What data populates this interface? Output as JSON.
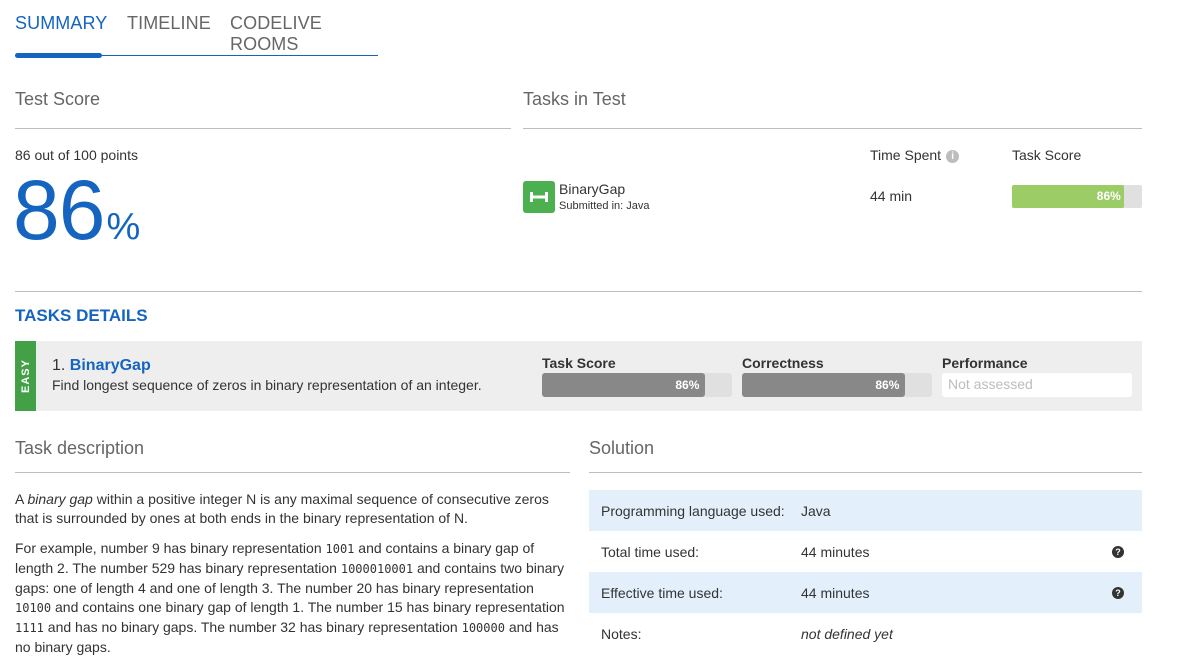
{
  "tabs": [
    "SUMMARY",
    "TIMELINE",
    "CODELIVE ROOMS"
  ],
  "test_score": {
    "title": "Test Score",
    "points_text": "86 out of 100 points",
    "percent_value": "86",
    "percent_sign": "%"
  },
  "tasks_in_test": {
    "title": "Tasks in Test",
    "time_spent_label": "Time Spent",
    "task_score_label": "Task Score",
    "task": {
      "name": "BinaryGap",
      "submitted": "Submitted in: Java",
      "time": "44 min",
      "score_label": "86%",
      "score_fraction": 0.86
    }
  },
  "tasks_details": {
    "title": "TASKS DETAILS",
    "row": {
      "difficulty": "EASY",
      "number": "1.",
      "name": "BinaryGap",
      "description": "Find longest sequence of zeros in binary representation of an integer.",
      "task_score_label": "Task Score",
      "task_score_value": "86%",
      "task_score_fraction": 0.86,
      "correctness_label": "Correctness",
      "correctness_value": "86%",
      "correctness_fraction": 0.86,
      "performance_label": "Performance",
      "performance_value": "Not assessed"
    }
  },
  "task_description": {
    "title": "Task description",
    "p1_a": "A ",
    "p1_em": "binary gap",
    "p1_b": " within a positive integer N is any maximal sequence of consecutive zeros that is surrounded by ones at both ends in the binary representation of N.",
    "p2_1": "For example, number 9 has binary representation ",
    "p2_c1": "1001",
    "p2_2": " and contains a binary gap of length 2. The number 529 has binary representation ",
    "p2_c2": "1000010001",
    "p2_3": " and contains two binary gaps: one of length 4 and one of length 3. The number 20 has binary representation ",
    "p2_c3": "10100",
    "p2_4": " and contains one binary gap of length 1. The number 15 has binary representation ",
    "p2_c4": "1111",
    "p2_5": " and has no binary gaps. The number 32 has binary representation ",
    "p2_c5": "100000",
    "p2_6": " and has no binary gaps."
  },
  "solution": {
    "title": "Solution",
    "rows": [
      {
        "key": "Programming language used:",
        "value": "Java"
      },
      {
        "key": "Total time used:",
        "value": "44 minutes"
      },
      {
        "key": "Effective time used:",
        "value": "44 minutes"
      },
      {
        "key": "Notes:",
        "value": "not defined yet"
      }
    ]
  },
  "colors": {
    "accent": "#1565c0",
    "easy_green": "#43a047",
    "score_green": "#9ccc65",
    "task_icon_green": "#4caf50"
  }
}
